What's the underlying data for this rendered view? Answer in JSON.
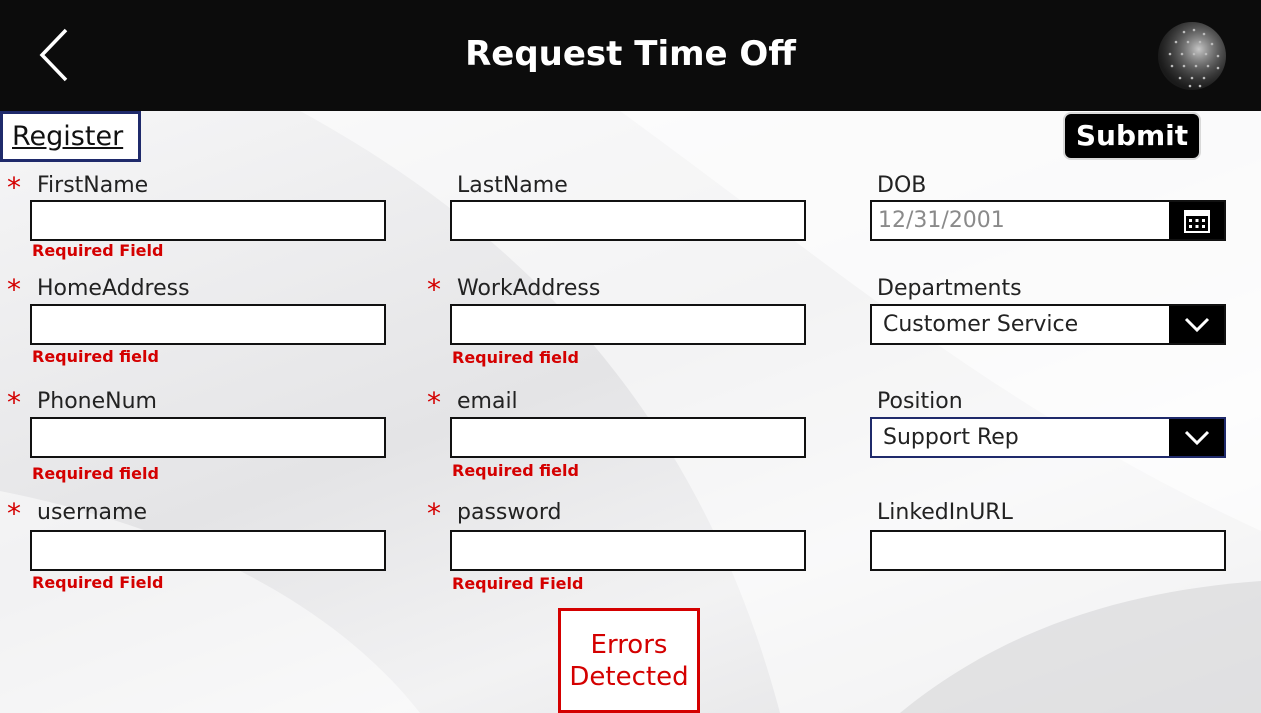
{
  "header": {
    "title": "Request Time Off",
    "back_icon": "chevron-left-icon",
    "logo_icon": "globe-logo-icon"
  },
  "actions": {
    "register_label": "Register",
    "submit_label": "Submit"
  },
  "fields": {
    "first_name": {
      "label": "FirstName",
      "required": true,
      "value": "",
      "error": "Required Field"
    },
    "last_name": {
      "label": "LastName",
      "required": false,
      "value": ""
    },
    "dob": {
      "label": "DOB",
      "value": "12/31/2001",
      "icon": "calendar-icon"
    },
    "home_address": {
      "label": "HomeAddress",
      "required": true,
      "value": "",
      "error": "Required field"
    },
    "work_address": {
      "label": "WorkAddress",
      "required": true,
      "value": "",
      "error": "Required field"
    },
    "departments": {
      "label": "Departments",
      "selected": "Customer Service",
      "icon": "chevron-down-icon"
    },
    "phone_num": {
      "label": "PhoneNum",
      "required": true,
      "value": "",
      "error": "Required field"
    },
    "email": {
      "label": "email",
      "required": true,
      "value": "",
      "error": "Required field"
    },
    "position": {
      "label": "Position",
      "selected": "Support Rep",
      "icon": "chevron-down-icon"
    },
    "username": {
      "label": "username",
      "required": true,
      "value": "",
      "error": "Required Field"
    },
    "password": {
      "label": "password",
      "required": true,
      "value": "",
      "error": "Required Field"
    },
    "linkedin_url": {
      "label": "LinkedInURL",
      "required": false,
      "value": ""
    }
  },
  "required_marker": "*",
  "status": {
    "errors_line1": "Errors",
    "errors_line2": "Detected"
  },
  "colors": {
    "header_bg": "#0c0c0c",
    "error_red": "#d40000",
    "navy_border": "#1f2a6b",
    "text": "#222222"
  }
}
